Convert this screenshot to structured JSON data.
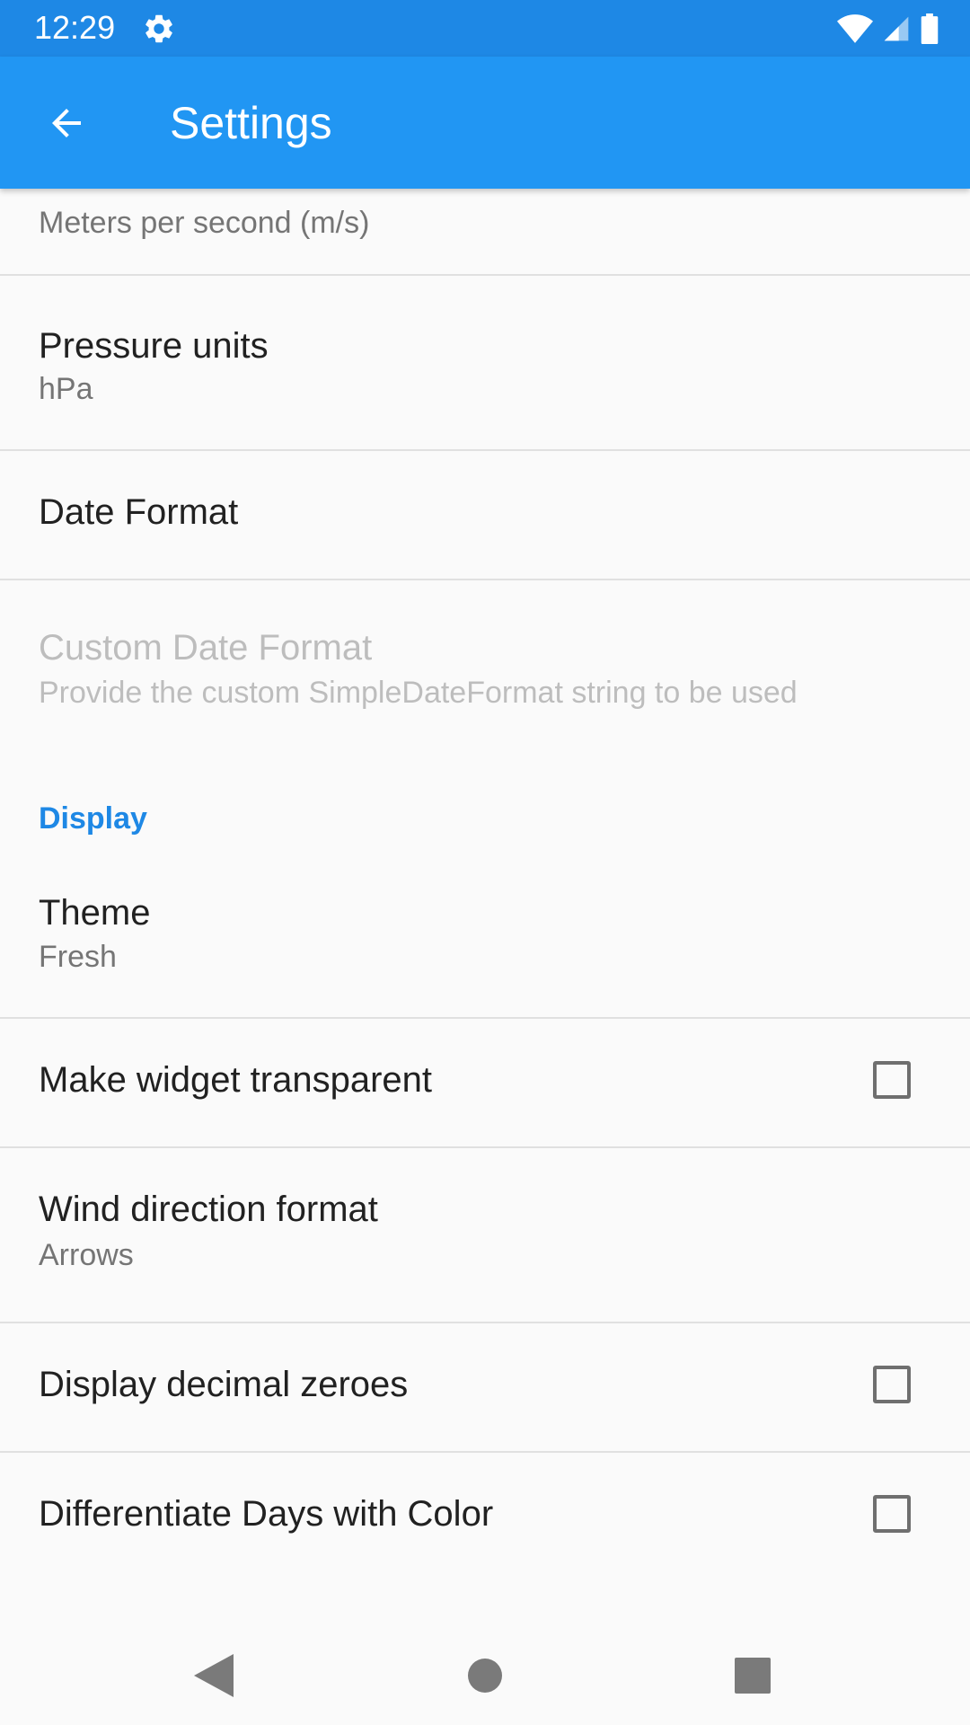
{
  "status_bar": {
    "time": "12:29",
    "icons": [
      "gear-icon",
      "wifi-icon",
      "cell-signal-icon",
      "battery-icon"
    ]
  },
  "app_bar": {
    "back_icon": "arrow-back-icon",
    "title": "Settings"
  },
  "colors": {
    "status_bar": "#1e88e5",
    "app_bar": "#2196f3",
    "accent": "#1e88e5",
    "background": "#fafafa"
  },
  "preferences": {
    "wind_speed_units": {
      "summary": "Meters per second (m/s)"
    },
    "pressure_units": {
      "title": "Pressure units",
      "summary": "hPa"
    },
    "date_format": {
      "title": "Date Format"
    },
    "custom_date_format": {
      "title": "Custom Date Format",
      "summary": "Provide the custom SimpleDateFormat string to be used",
      "enabled": false
    },
    "display_category": "Display",
    "theme": {
      "title": "Theme",
      "summary": "Fresh"
    },
    "widget_transparent": {
      "title": "Make widget transparent",
      "checked": false
    },
    "wind_direction_format": {
      "title": "Wind direction format",
      "summary": "Arrows"
    },
    "display_decimal_zeroes": {
      "title": "Display decimal zeroes",
      "checked": false
    },
    "differentiate_days_color": {
      "title": "Differentiate Days with Color",
      "checked": false
    }
  },
  "nav_bar": {
    "buttons": [
      "back-triangle-icon",
      "home-circle-icon",
      "recents-square-icon"
    ]
  }
}
